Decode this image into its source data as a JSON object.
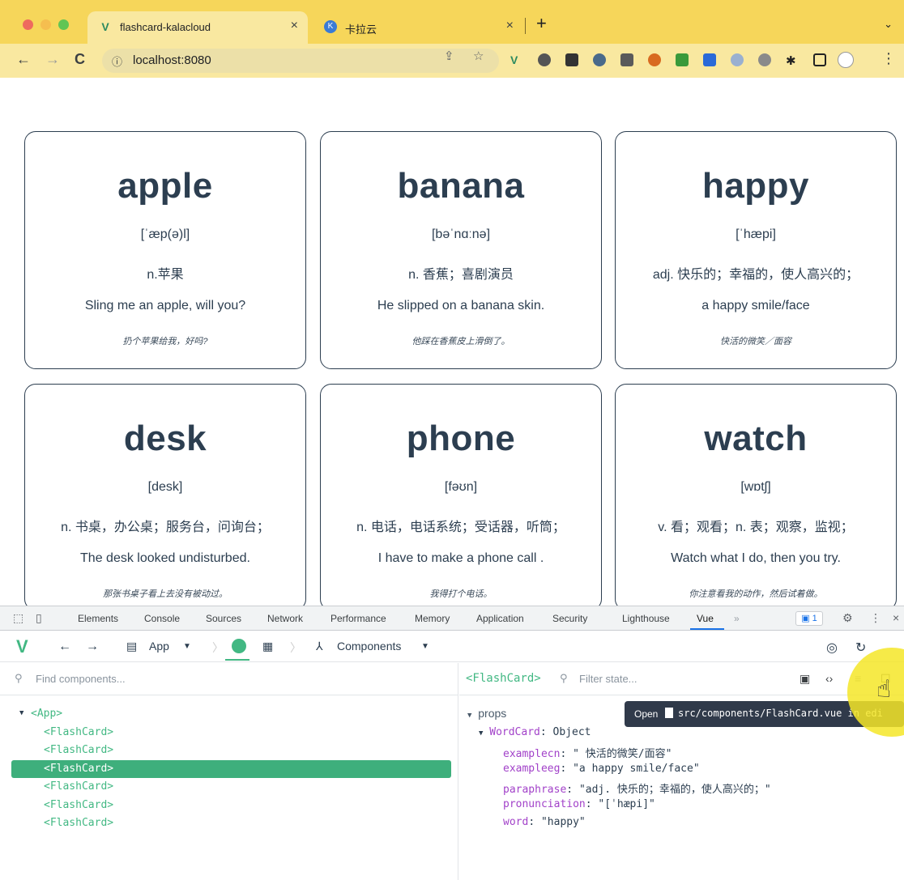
{
  "browser": {
    "tabs": [
      {
        "title": "flashcard-kalacloud",
        "active": true,
        "favicon": "vue-logo-icon"
      },
      {
        "title": "卡拉云",
        "active": false,
        "favicon": "kalacloud-icon"
      }
    ],
    "new_tab": "+",
    "url": "localhost:8080",
    "colors": {
      "tabbar": "#f6d65a",
      "toolbar": "#f9e8a0"
    }
  },
  "cards": [
    {
      "word": "apple",
      "pronunciation": "[ˈæp(ə)l]",
      "paraphrase": "n.苹果",
      "example_en": "Sling me an apple, will you?",
      "example_cn": "扔个苹果给我，好吗?"
    },
    {
      "word": "banana",
      "pronunciation": "[bəˈnɑːnə]",
      "paraphrase": "n. 香蕉；喜剧演员",
      "example_en": "He slipped on a banana skin.",
      "example_cn": "他踩在香蕉皮上滑倒了。"
    },
    {
      "word": "happy",
      "pronunciation": "[ˈhæpi]",
      "paraphrase": "adj. 快乐的；幸福的，使人高兴的；",
      "example_en": "a happy smile/face",
      "example_cn": "快活的微笑／面容"
    },
    {
      "word": "desk",
      "pronunciation": "[desk]",
      "paraphrase": "n. 书桌，办公桌；服务台，问询台；",
      "example_en": "The desk looked undisturbed.",
      "example_cn": "那张书桌子看上去没有被动过。"
    },
    {
      "word": "phone",
      "pronunciation": "[fəʊn]",
      "paraphrase": "n. 电话，电话系统；受话器，听筒；",
      "example_en": "I have to make a phone call .",
      "example_cn": "我得打个电话。"
    },
    {
      "word": "watch",
      "pronunciation": "[wɒtʃ]",
      "paraphrase": "v. 看；观看；n. 表；观察，监视；",
      "example_en": "Watch what I do, then you try.",
      "example_cn": "你注意看我的动作，然后试着做。"
    }
  ],
  "devtools": {
    "tabs": [
      "Elements",
      "Console",
      "Sources",
      "Network",
      "Performance",
      "Memory",
      "Application",
      "Security",
      "Lighthouse",
      "Vue"
    ],
    "active_tab": "Vue",
    "more": "»",
    "issues_count": "1",
    "vue": {
      "app_selector": "App",
      "view_selector": "Components",
      "find_placeholder": "Find components...",
      "tree": [
        {
          "label": "<App>",
          "indent": 0
        },
        {
          "label": "<FlashCard>",
          "indent": 1
        },
        {
          "label": "<FlashCard>",
          "indent": 1
        },
        {
          "label": "<FlashCard>",
          "indent": 1,
          "selected": true
        },
        {
          "label": "<FlashCard>",
          "indent": 1
        },
        {
          "label": "<FlashCard>",
          "indent": 1
        },
        {
          "label": "<FlashCard>",
          "indent": 1
        }
      ],
      "selected_component": "<FlashCard>",
      "filter_placeholder": "Filter state...",
      "props_header": "props",
      "object_key": "WordCard",
      "object_type": "Object",
      "props": [
        {
          "key": "examplecn",
          "value": "\" 快活的微笑/面容\""
        },
        {
          "key": "exampleeg",
          "value": "\"a happy smile/face\""
        },
        {
          "key": "paraphrase",
          "value": "\"adj. 快乐的；幸福的，使人高兴的；\""
        },
        {
          "key": "pronunciation",
          "value": "\"[ˈhæpi]\""
        },
        {
          "key": "word",
          "value": "\"happy\""
        }
      ],
      "tooltip_open": "Open",
      "tooltip_path": "src/components/FlashCard.vue in edi"
    }
  }
}
